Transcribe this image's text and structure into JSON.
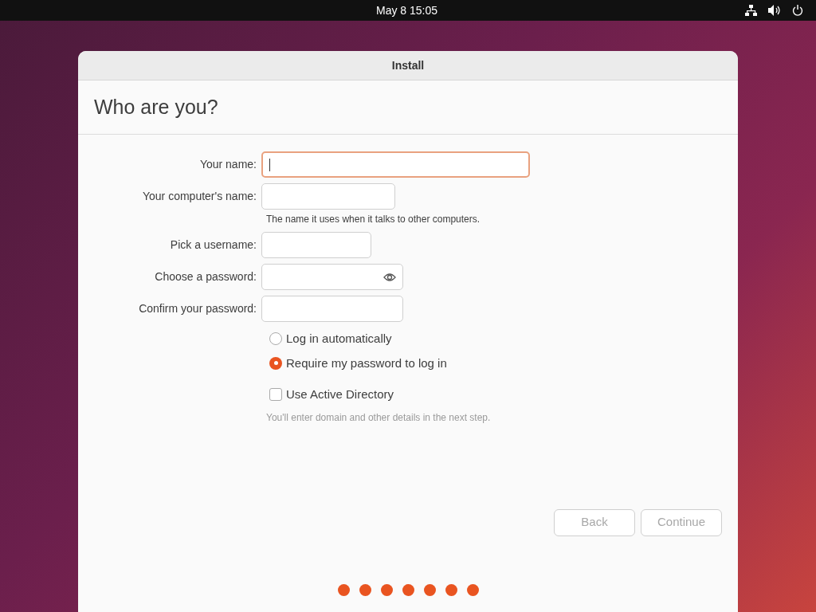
{
  "top_bar": {
    "clock": "May 8  15:05"
  },
  "window": {
    "title": "Install"
  },
  "heading": "Who are you?",
  "fields": [
    {
      "label": "Your name:",
      "kind": "text",
      "focused": true
    },
    {
      "label": "Your computer's name:",
      "kind": "text",
      "focused": false,
      "hint": "The name it uses when it talks to other computers."
    },
    {
      "label": "Pick a username:",
      "kind": "text",
      "focused": false
    },
    {
      "label": "Choose a password:",
      "kind": "password",
      "focused": false
    },
    {
      "label": "Confirm your password:",
      "kind": "text",
      "focused": false
    }
  ],
  "login_options": [
    {
      "label": "Log in automatically",
      "selected": false
    },
    {
      "label": "Require my password to log in",
      "selected": true
    }
  ],
  "active_directory": {
    "label": "Use Active Directory",
    "checked": false,
    "hint": "You'll enter domain and other details in the next step."
  },
  "buttons": [
    {
      "label": "Back",
      "disabled": true
    },
    {
      "label": "Continue",
      "disabled": true
    }
  ],
  "steps": [
    {
      "done": true
    },
    {
      "done": true
    },
    {
      "done": true
    },
    {
      "done": true
    },
    {
      "done": true
    },
    {
      "done": true
    },
    {
      "done": true
    }
  ]
}
